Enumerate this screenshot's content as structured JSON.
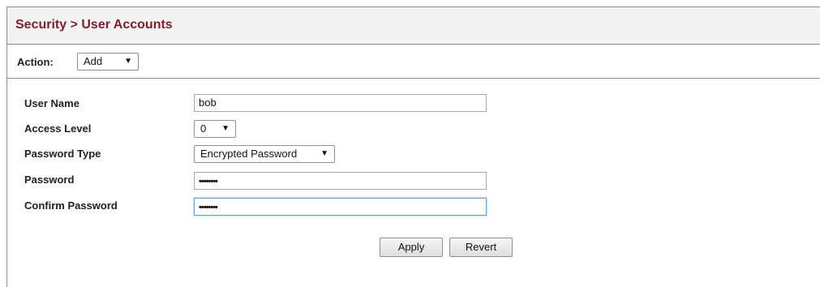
{
  "header": {
    "title": "Security > User Accounts"
  },
  "action": {
    "label": "Action:",
    "selected": "Add"
  },
  "form": {
    "user_name": {
      "label": "User Name",
      "value": "bob"
    },
    "access_level": {
      "label": "Access Level",
      "selected": "0"
    },
    "password_type": {
      "label": "Password Type",
      "selected": "Encrypted Password"
    },
    "password": {
      "label": "Password",
      "masked_value": "••••••••"
    },
    "confirm_password": {
      "label": "Confirm Password",
      "masked_value": "••••••••"
    }
  },
  "buttons": {
    "apply": "Apply",
    "revert": "Revert"
  },
  "icons": {
    "dropdown": "dropdown-arrow-icon"
  },
  "colors": {
    "title": "#7a1f2e",
    "focus_border": "#6f9fd8"
  }
}
